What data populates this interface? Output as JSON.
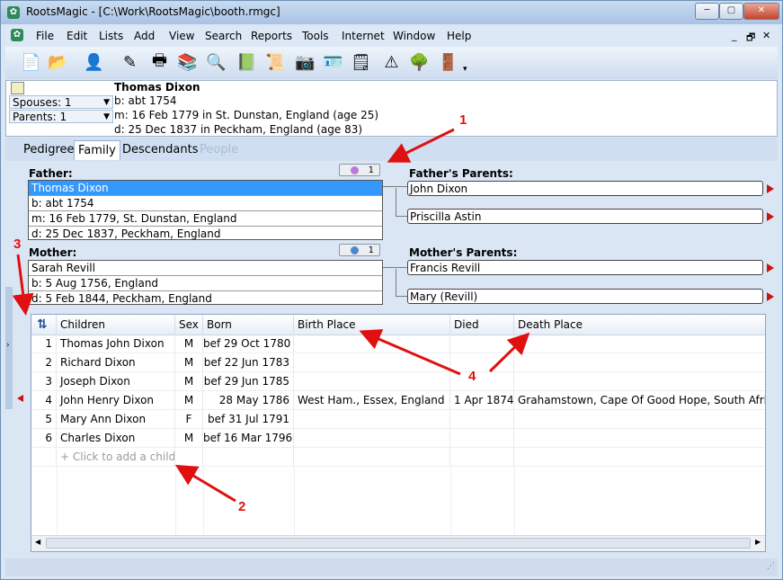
{
  "window": {
    "title": "RootsMagic - [C:\\Work\\RootsMagic\\booth.rmgc]",
    "min_glyph": "─",
    "max_glyph": "▢",
    "close_glyph": "✕"
  },
  "menu": [
    "File",
    "Edit",
    "Lists",
    "Add",
    "View",
    "Search",
    "Reports",
    "Tools",
    "Internet",
    "Window",
    "Help"
  ],
  "mdi": {
    "minimize": "_",
    "restore": "🗗",
    "close": "✕"
  },
  "toolbar_icons": [
    "new-file-icon",
    "open-folder-icon",
    "add-person-icon",
    "edit-person-icon",
    "print-icon",
    "books-icon",
    "search-magnifier-icon",
    "sourcebook-icon",
    "certificate-icon",
    "camera-icon",
    "id-card-icon",
    "sticky-note-icon",
    "road-sign-icon",
    "tree-icon",
    "exit-door-icon"
  ],
  "person": {
    "name": "Thomas Dixon",
    "birth": "b: abt 1754",
    "marriage": "m: 16 Feb 1779 in St. Dunstan, England (age 25)",
    "death": "d: 25 Dec 1837 in Peckham, England (age 83)",
    "spouses_label": "Spouses: 1",
    "parents_label": "Parents: 1"
  },
  "tabs": [
    "Pedigree",
    "Family",
    "Descendants",
    "People"
  ],
  "family": {
    "father_heading": "Father:",
    "mother_heading": "Mother:",
    "father": [
      "Thomas Dixon",
      "b: abt 1754",
      "m: 16 Feb 1779, St. Dunstan, England",
      "d: 25 Dec 1837, Peckham, England"
    ],
    "mother": [
      "Sarah Revill",
      "b: 5 Aug 1756, England",
      "d: 5 Feb 1844, Peckham, England"
    ],
    "father_spouse_count": "1",
    "mother_spouse_count": "1",
    "fathers_parents_heading": "Father's Parents:",
    "mothers_parents_heading": "Mother's Parents:",
    "fathers_parents": [
      "John Dixon",
      "Priscilla Astin"
    ],
    "mothers_parents": [
      "Francis Revill",
      "Mary (Revill)"
    ]
  },
  "children_table": {
    "headers": [
      "Children",
      "Sex",
      "Born",
      "Birth Place",
      "Died",
      "Death Place"
    ],
    "rows": [
      {
        "num": "1",
        "name": "Thomas John Dixon",
        "sex": "M",
        "born": "bef 29 Oct 1780",
        "birth_place": "",
        "died": "",
        "death_place": ""
      },
      {
        "num": "2",
        "name": "Richard Dixon",
        "sex": "M",
        "born": "bef 22 Jun 1783",
        "birth_place": "",
        "died": "",
        "death_place": ""
      },
      {
        "num": "3",
        "name": "Joseph Dixon",
        "sex": "M",
        "born": "bef 29 Jun 1785",
        "birth_place": "",
        "died": "",
        "death_place": ""
      },
      {
        "num": "4",
        "name": "John Henry Dixon",
        "sex": "M",
        "born": "28 May 1786",
        "birth_place": "West Ham., Essex, England",
        "died": "1 Apr 1874",
        "death_place": "Grahamstown, Cape Of Good Hope, South Afric"
      },
      {
        "num": "5",
        "name": "Mary Ann Dixon",
        "sex": "F",
        "born": "bef 31 Jul 1791",
        "birth_place": "",
        "died": "",
        "death_place": ""
      },
      {
        "num": "6",
        "name": "Charles Dixon",
        "sex": "M",
        "born": "bef 16 Mar 1796",
        "birth_place": "",
        "died": "",
        "death_place": ""
      }
    ],
    "add_child_text": "+ Click to add a child",
    "sort_icon": "sort-arrows-icon"
  },
  "annotations": [
    "1",
    "2",
    "3",
    "4"
  ],
  "colors": {
    "selection": "#3399ff",
    "annotation": "#e01010",
    "pointer_triangle": "#cc1111"
  }
}
